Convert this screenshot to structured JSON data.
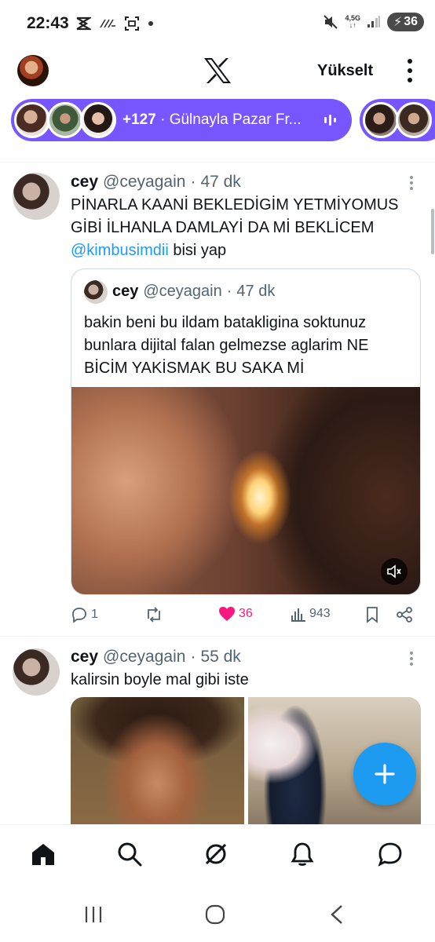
{
  "status_bar": {
    "time": "22:43",
    "network_label": "4,5G",
    "battery": "36",
    "icons": [
      "unknown-x-icon",
      "wifi-call-icon",
      "screenshot-icon",
      "dot-icon",
      "mute-icon",
      "signal-icon",
      "battery-icon"
    ]
  },
  "header": {
    "upgrade_label": "Yükselt",
    "logo": "x-logo-icon"
  },
  "spaces": {
    "count_label": "+127",
    "separator": " · ",
    "title": "Gülnayla Pazar Fr..."
  },
  "tweets": [
    {
      "name": "cey",
      "handle": "@ceyagain",
      "dot": "·",
      "time": "47 dk",
      "text_line1": "PİNARLA KAANİ BEKLEDİGİM YETMİYOMUS",
      "text_line2": "GİBİ İLHANLA DAMLAYİ DA Mİ BEKLİCEM",
      "mention": "@kimbusimdii",
      "text_after_mention": " bisi yap",
      "quote": {
        "name": "cey",
        "handle": "@ceyagain",
        "dot": "·",
        "time": "47 dk",
        "text": "bakin beni bu ildam batakligina soktunuz bunlara dijital falan gelmezse aglarim NE BİCİM YAKİSMAK BU SAKA Mİ"
      },
      "actions": {
        "replies": "1",
        "reposts": "",
        "likes": "36",
        "views": "943"
      }
    },
    {
      "name": "cey",
      "handle": "@ceyagain",
      "dot": "·",
      "time": "55 dk",
      "text": "kalirsin boyle mal gibi iste"
    }
  ],
  "colors": {
    "accent": "#1d9bf0",
    "spaces_purple": "#7856ff",
    "like_pink": "#f91880",
    "secondary_text": "#536471"
  }
}
